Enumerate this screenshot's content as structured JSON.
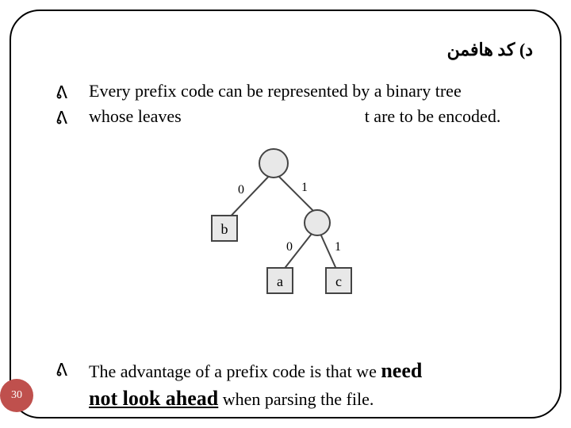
{
  "title_rtl": "د) کد هافمن",
  "bullets": {
    "b1_a": "Every prefix code can be represented by a binary tree",
    "b2_a": "whose leaves",
    "b2_b": "t are to be encoded."
  },
  "advantage": {
    "lead": "The advantage of a prefix code is that we ",
    "need": "need",
    "notlook": "not look ahead",
    "tail": " when parsing the file."
  },
  "page_number": "30",
  "tree": {
    "root_left_label": "0",
    "root_right_label": "1",
    "mid_left_label": "0",
    "mid_right_label": "1",
    "leaf_b": "b",
    "leaf_a": "a",
    "leaf_c": "c"
  }
}
